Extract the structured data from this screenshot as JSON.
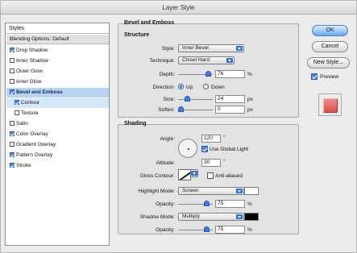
{
  "window": {
    "title": "Layer Style"
  },
  "styles_panel": {
    "header": "Styles",
    "default_item": "Blending Options: Default",
    "items": [
      {
        "label": "Drop Shadow",
        "checked": true
      },
      {
        "label": "Inner Shadow",
        "checked": false
      },
      {
        "label": "Outer Glow",
        "checked": false
      },
      {
        "label": "Inner Glow",
        "checked": false
      },
      {
        "label": "Bevel and Emboss",
        "checked": true,
        "selected": true
      },
      {
        "label": "Contour",
        "checked": true
      },
      {
        "label": "Texture",
        "checked": false
      },
      {
        "label": "Satin",
        "checked": false
      },
      {
        "label": "Color Overlay",
        "checked": true
      },
      {
        "label": "Gradient Overlay",
        "checked": false
      },
      {
        "label": "Pattern Overlay",
        "checked": true
      },
      {
        "label": "Stroke",
        "checked": true
      }
    ]
  },
  "bevel": {
    "section_title": "Bevel and Emboss",
    "structure_title": "Structure",
    "style_label": "Style:",
    "style_value": "Inner Bevel",
    "technique_label": "Technique:",
    "technique_value": "Chisel Hard",
    "depth_label": "Depth:",
    "depth_value": "76",
    "depth_unit": "%",
    "direction_label": "Direction:",
    "direction_up": "Up",
    "direction_down": "Down",
    "size_label": "Size:",
    "size_value": "24",
    "size_unit": "px",
    "soften_label": "Soften:",
    "soften_value": "0",
    "soften_unit": "px"
  },
  "shading": {
    "title": "Shading",
    "angle_label": "Angle:",
    "angle_value": "120",
    "angle_unit": "°",
    "global_light_label": "Use Global Light",
    "altitude_label": "Altitude:",
    "altitude_value": "30",
    "altitude_unit": "°",
    "gloss_label": "Gloss Contour:",
    "anti_aliased_label": "Anti-aliased",
    "highlight_mode_label": "Highlight Mode:",
    "highlight_mode_value": "Screen",
    "highlight_opacity_label": "Opacity:",
    "highlight_opacity_value": "75",
    "highlight_opacity_unit": "%",
    "shadow_mode_label": "Shadow Mode:",
    "shadow_mode_value": "Multiply",
    "shadow_opacity_label": "Opacity:",
    "shadow_opacity_value": "75",
    "shadow_opacity_unit": "%",
    "highlight_color": "#ffffff",
    "shadow_color": "#000000"
  },
  "buttons": {
    "ok": "OK",
    "cancel": "Cancel",
    "new_style": "New Style...",
    "preview": "Preview"
  }
}
